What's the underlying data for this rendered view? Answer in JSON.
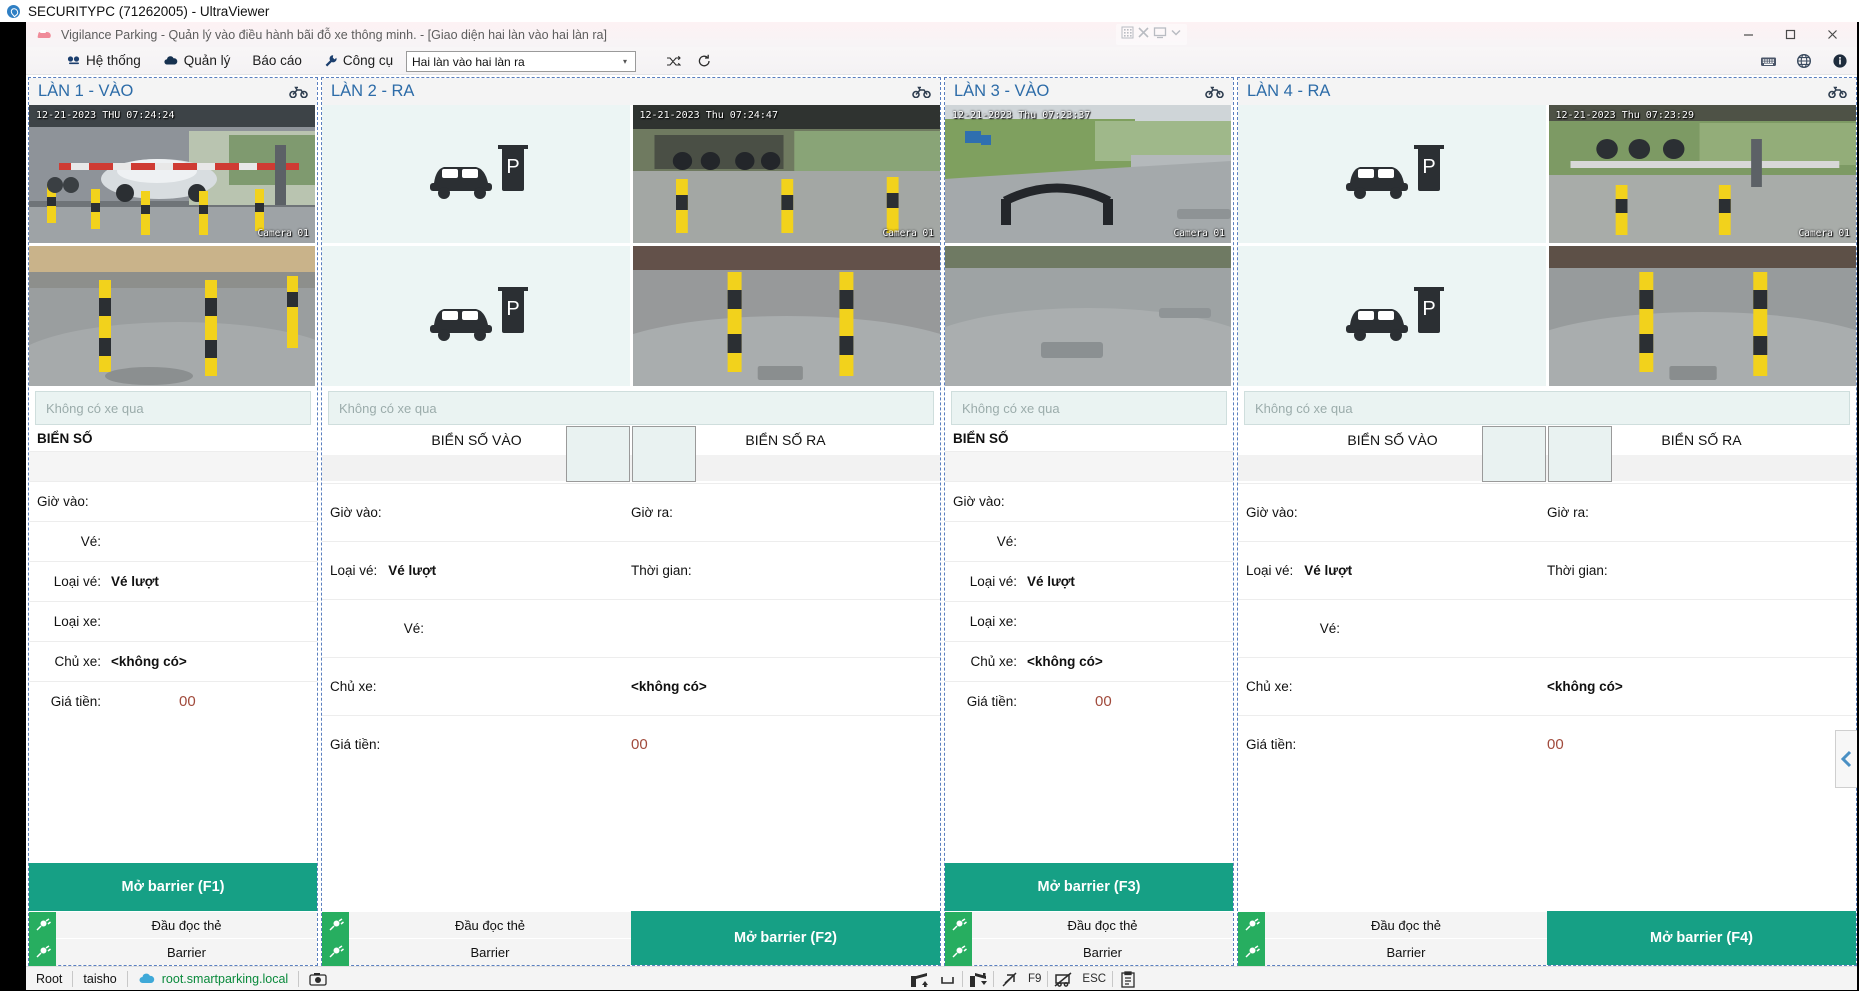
{
  "ultraviewer": {
    "title": "SECURITYPC (71262005) - UltraViewer",
    "logo_icon": "ultraviewer-logo-icon",
    "mini_toolbar": [
      {
        "name": "keypad-icon",
        "glyph": "▦"
      },
      {
        "name": "fullscreen-icon",
        "glyph": "✕"
      },
      {
        "name": "monitor-icon",
        "glyph": "🖥"
      },
      {
        "name": "chevron-down-icon",
        "glyph": "⌄"
      }
    ]
  },
  "app": {
    "icon": "parking-app-icon",
    "title": "Vigilance Parking - Quản lý vào điều hành bãi đỗ xe thông minh. - [Giao diện hai làn vào hai làn ra]",
    "window_buttons": [
      {
        "name": "minimize-button",
        "glyph": "—"
      },
      {
        "name": "maximize-button",
        "glyph": "❐"
      },
      {
        "name": "close-button",
        "glyph": "✕"
      }
    ]
  },
  "menubar": {
    "items": [
      {
        "label": "Hệ thống",
        "icon": "system-icon",
        "name": "menu-he-thong"
      },
      {
        "label": "Quản lý",
        "icon": "cloud-icon",
        "name": "menu-quan-ly"
      },
      {
        "label": "Báo cáo",
        "icon": "",
        "name": "menu-bao-cao"
      },
      {
        "label": "Công cụ",
        "icon": "wrench-icon",
        "name": "menu-cong-cu"
      }
    ],
    "mode_select": {
      "value": "Hai làn vào hai làn ra",
      "caret_icon": "chevron-down-icon"
    },
    "shuffle_icon": "shuffle-icon",
    "refresh_icon": "refresh-icon",
    "right_icons": [
      {
        "name": "keyboard-icon",
        "glyph": "⌨"
      },
      {
        "name": "globe-icon",
        "glyph": "🌐"
      },
      {
        "name": "info-icon",
        "glyph": "ⓘ"
      }
    ]
  },
  "labels": {
    "plate_header": "BIỂN SỐ",
    "plate_in_header": "BIỂN SỐ VÀO",
    "plate_out_header": "BIỂN SỐ RA",
    "time_in": "Giờ vào:",
    "time_out": "Giờ ra:",
    "ticket": "Vé:",
    "ticket_type": "Loại vé:",
    "vehicle_type": "Loại xe:",
    "owner": "Chủ xe:",
    "price": "Giá tiền:",
    "duration": "Thời gian:",
    "card_reader": "Đầu đọc thẻ",
    "barrier": "Barrier",
    "no_vehicle_placeholder": "Không có xe qua"
  },
  "values": {
    "ticket_type": "Vé lượt",
    "owner_none": "<không có>",
    "price": "00",
    "empty": ""
  },
  "colors": {
    "accent_green": "#16a085",
    "device_green": "#27ae60",
    "lane_title": "#2d6ca8",
    "money": "#a14b3c"
  },
  "lanes": [
    {
      "name": "lane-1",
      "title": "LÀN 1 - VÀO",
      "type": "entry",
      "bike_icon": "motorcycle-icon",
      "open_barrier_label": "Mở barrier (F1)",
      "cameras": [
        {
          "name": "camera-1-top",
          "timestamp": "12-21-2023 THU 07:24:24",
          "label": "Camera 01",
          "has_video": true
        },
        {
          "name": "camera-1-bottom",
          "timestamp": "",
          "label": "",
          "has_video": true
        }
      ]
    },
    {
      "name": "lane-2",
      "title": "LÀN 2 - RA",
      "type": "exit",
      "bike_icon": "motorcycle-icon",
      "open_barrier_label": "Mở barrier (F2)",
      "cameras": [
        {
          "name": "camera-2-left-top",
          "timestamp": "",
          "label": "",
          "has_video": false
        },
        {
          "name": "camera-2-right-top",
          "timestamp": "12-21-2023 Thu 07:24:47",
          "label": "Camera 01",
          "has_video": true
        },
        {
          "name": "camera-2-left-bottom",
          "timestamp": "",
          "label": "",
          "has_video": false
        },
        {
          "name": "camera-2-right-bottom",
          "timestamp": "",
          "label": "",
          "has_video": true
        }
      ]
    },
    {
      "name": "lane-3",
      "title": "LÀN 3 - VÀO",
      "type": "entry",
      "bike_icon": "motorcycle-icon",
      "open_barrier_label": "Mở barrier (F3)",
      "cameras": [
        {
          "name": "camera-3-top",
          "timestamp": "12-21-2023 Thu 07:23:37",
          "label": "Camera 01",
          "has_video": true
        },
        {
          "name": "camera-3-bottom",
          "timestamp": "",
          "label": "",
          "has_video": true
        }
      ]
    },
    {
      "name": "lane-4",
      "title": "LÀN 4 - RA",
      "type": "exit",
      "bike_icon": "motorcycle-icon",
      "open_barrier_label": "Mở barrier (F4)",
      "cameras": [
        {
          "name": "camera-4-left-top",
          "timestamp": "",
          "label": "",
          "has_video": false
        },
        {
          "name": "camera-4-right-top",
          "timestamp": "12-21-2023 Thu 07:23:29",
          "label": "Camera 01",
          "has_video": true
        },
        {
          "name": "camera-4-left-bottom",
          "timestamp": "",
          "label": "",
          "has_video": false
        },
        {
          "name": "camera-4-right-bottom",
          "timestamp": "",
          "label": "",
          "has_video": true
        }
      ]
    }
  ],
  "collapse_tab": {
    "name": "collapse-panel-tab",
    "icon": "chevron-left-icon"
  },
  "statusbar": {
    "user_role": "Root",
    "user_name": "taisho",
    "host": "root.smartparking.local",
    "cloud_icon": "cloud-icon",
    "camera_icon": "camera-icon",
    "tools": [
      {
        "name": "barrier-open-icon",
        "glyph": "barrier-up"
      },
      {
        "name": "loop-icon",
        "glyph": "loop"
      },
      {
        "name": "barrier-close-icon",
        "glyph": "barrier-down"
      },
      {
        "name": "no-ticket-icon",
        "glyph": "no-ticket"
      },
      {
        "name": "f9-key-label",
        "glyph": "F9"
      },
      {
        "name": "no-vehicle-icon",
        "glyph": "no-vehicle"
      },
      {
        "name": "esc-key-label",
        "glyph": "ESC"
      },
      {
        "name": "report-clipboard-icon",
        "glyph": "clipboard"
      }
    ]
  }
}
